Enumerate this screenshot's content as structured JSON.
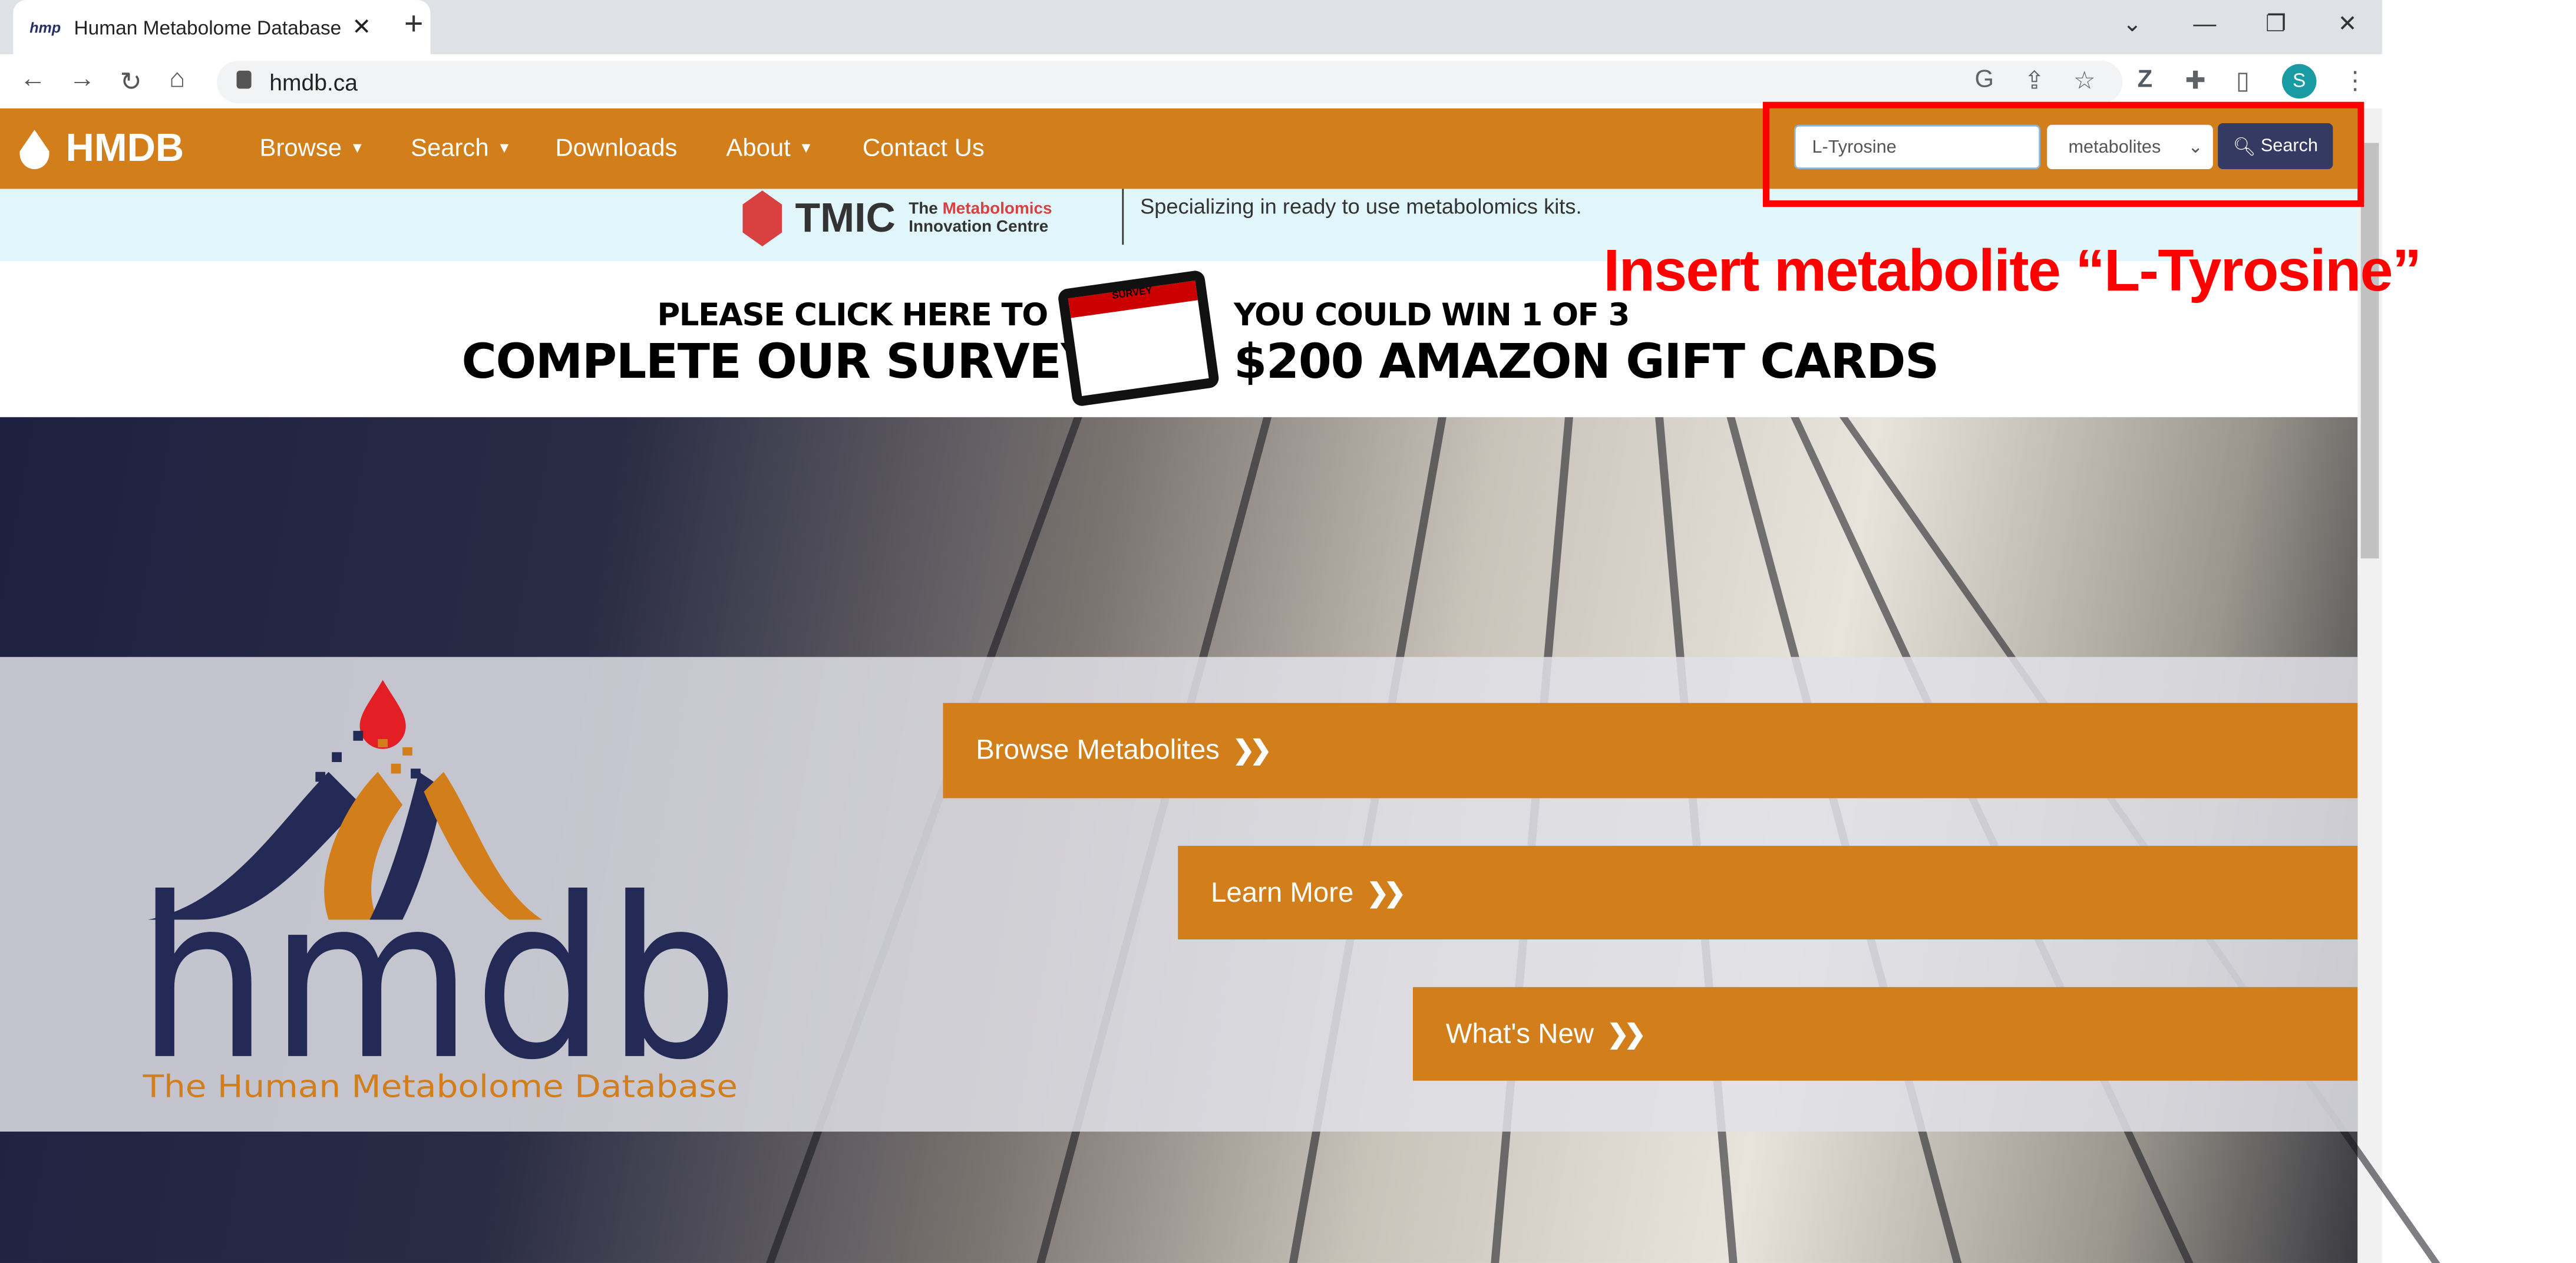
{
  "browser": {
    "tab_title": "Human Metabolome Database",
    "tab_favicon_text": "hmp",
    "url": "hmdb.ca",
    "avatar_letter": "S",
    "toolbar_icons": [
      "translate-icon",
      "share-icon",
      "star-icon",
      "z-extension-icon",
      "puzzle-icon",
      "side-panel-icon",
      "avatar",
      "more-icon"
    ]
  },
  "nav": {
    "brand": "HMDB",
    "items": [
      {
        "label": "Browse",
        "dropdown": true
      },
      {
        "label": "Search",
        "dropdown": true
      },
      {
        "label": "Downloads",
        "dropdown": false
      },
      {
        "label": "About",
        "dropdown": true
      },
      {
        "label": "Contact Us",
        "dropdown": false
      }
    ],
    "search_value": "L-Tyrosine",
    "search_type": "metabolites",
    "search_button": "Search"
  },
  "tmic_banner": {
    "acronym": "TMIC",
    "line1_prefix": "The",
    "line1_highlight": "Metabolomics",
    "line2": "Innovation Centre",
    "tagline": "Specializing in ready to use metabolomics kits."
  },
  "survey_banner": {
    "left_line1": "PLEASE CLICK HERE TO",
    "left_line2": "COMPLETE OUR SURVEY",
    "tablet_label": "SURVEY",
    "right_line1": "YOU COULD WIN 1 OF 3",
    "right_line2": "$200 AMAZON GIFT CARDS"
  },
  "hero": {
    "logo_text": "hmdb",
    "logo_subtitle": "The Human Metabolome Database",
    "buttons": [
      "Browse Metabolites",
      "Learn More",
      "What's New"
    ]
  },
  "annotation": {
    "text": "Insert metabolite “L-Tyrosine”",
    "color": "#ff0000"
  },
  "colors": {
    "brand_orange": "#d17e1b",
    "navy": "#232a55",
    "search_button": "#343a62"
  }
}
